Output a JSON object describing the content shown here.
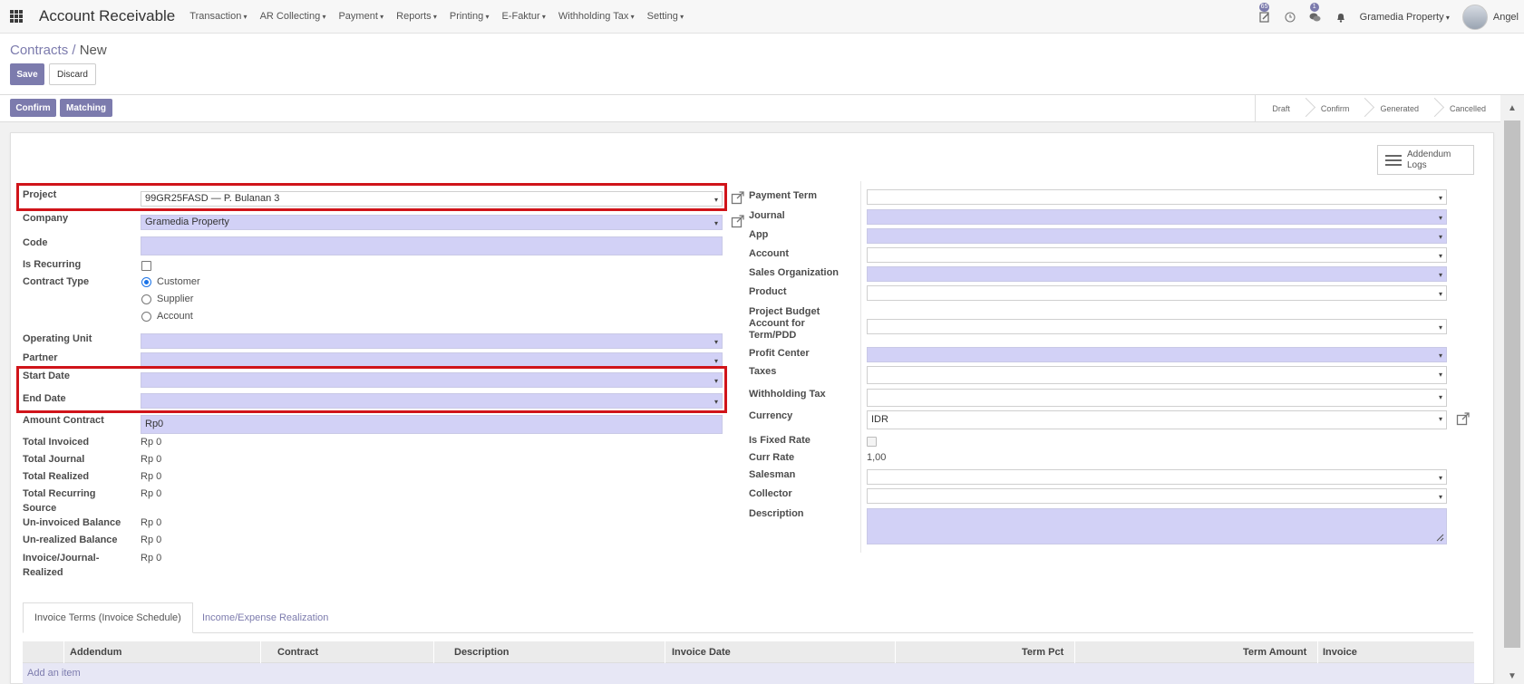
{
  "topbar": {
    "app_title": "Account Receivable",
    "menu": [
      "Transaction",
      "AR Collecting",
      "Payment",
      "Reports",
      "Printing",
      "E-Faktur",
      "Withholding Tax",
      "Setting"
    ],
    "activity_badge": "65",
    "messages_badge": "1",
    "company": "Gramedia Property",
    "user": "Angel",
    "icons": [
      "apps-grid-icon",
      "activity-icon",
      "clock-icon",
      "chat-icon",
      "bell-icon"
    ]
  },
  "control_panel": {
    "breadcrumb_parent": "Contracts",
    "breadcrumb_sep": "/",
    "breadcrumb_current": "New",
    "save_label": "Save",
    "discard_label": "Discard"
  },
  "statusbar": {
    "confirm_label": "Confirm",
    "matching_label": "Matching",
    "stages": [
      "Draft",
      "Confirm",
      "Generated",
      "Cancelled"
    ]
  },
  "addendum_button": {
    "line1": "Addendum",
    "line2": "Logs"
  },
  "left_form": {
    "project_label": "Project",
    "project_value": "99GR25FASD — P. Bulanan 3",
    "company_label": "Company",
    "company_value": "Gramedia Property",
    "code_label": "Code",
    "code_value": "",
    "is_recurring_label": "Is Recurring",
    "contract_type_label": "Contract Type",
    "contract_type_options": [
      "Customer",
      "Supplier",
      "Account"
    ],
    "contract_type_selected": "Customer",
    "operating_unit_label": "Operating Unit",
    "partner_label": "Partner",
    "start_date_label": "Start Date",
    "end_date_label": "End Date",
    "amount_contract_label": "Amount Contract",
    "amount_contract_value": "Rp0",
    "total_invoiced_label": "Total Invoiced",
    "total_invoiced_value": "Rp 0",
    "total_journal_label": "Total Journal",
    "total_journal_value": "Rp 0",
    "total_realized_label": "Total Realized",
    "total_realized_value": "Rp 0",
    "total_recurring_label_1": "Total Recurring",
    "total_recurring_label_2": "Source",
    "total_recurring_value": "Rp 0",
    "uninvoiced_label": "Un-invoiced Balance",
    "uninvoiced_value": "Rp 0",
    "unrealized_label": "Un-realized Balance",
    "unrealized_value": "Rp 0",
    "inv_journal_label_1": "Invoice/Journal-",
    "inv_journal_label_2": "Realized",
    "inv_journal_value": "Rp 0"
  },
  "right_form": {
    "payment_term_label": "Payment Term",
    "journal_label": "Journal",
    "app_label": "App",
    "account_label": "Account",
    "sales_org_label": "Sales Organization",
    "product_label": "Product",
    "project_budget_label_1": "Project Budget",
    "project_budget_label_2": "Account for",
    "project_budget_label_3": "Term/PDD",
    "profit_center_label": "Profit Center",
    "taxes_label": "Taxes",
    "withholding_tax_label": "Withholding Tax",
    "currency_label": "Currency",
    "currency_value": "IDR",
    "is_fixed_rate_label": "Is Fixed Rate",
    "curr_rate_label": "Curr Rate",
    "curr_rate_value": "1,00",
    "salesman_label": "Salesman",
    "collector_label": "Collector",
    "description_label": "Description"
  },
  "tabs": {
    "items": [
      "Invoice Terms (Invoice Schedule)",
      "Income/Expense Realization"
    ],
    "active": "Invoice Terms (Invoice Schedule)"
  },
  "table": {
    "columns": [
      "Addendum",
      "Contract",
      "Description",
      "Invoice Date",
      "Term Pct",
      "Term Amount",
      "Invoice"
    ],
    "add_item_label": "Add an item"
  },
  "colors": {
    "primary": "#7c7bad",
    "required_field": "#d2d1f6",
    "highlight": "#d0141a"
  }
}
